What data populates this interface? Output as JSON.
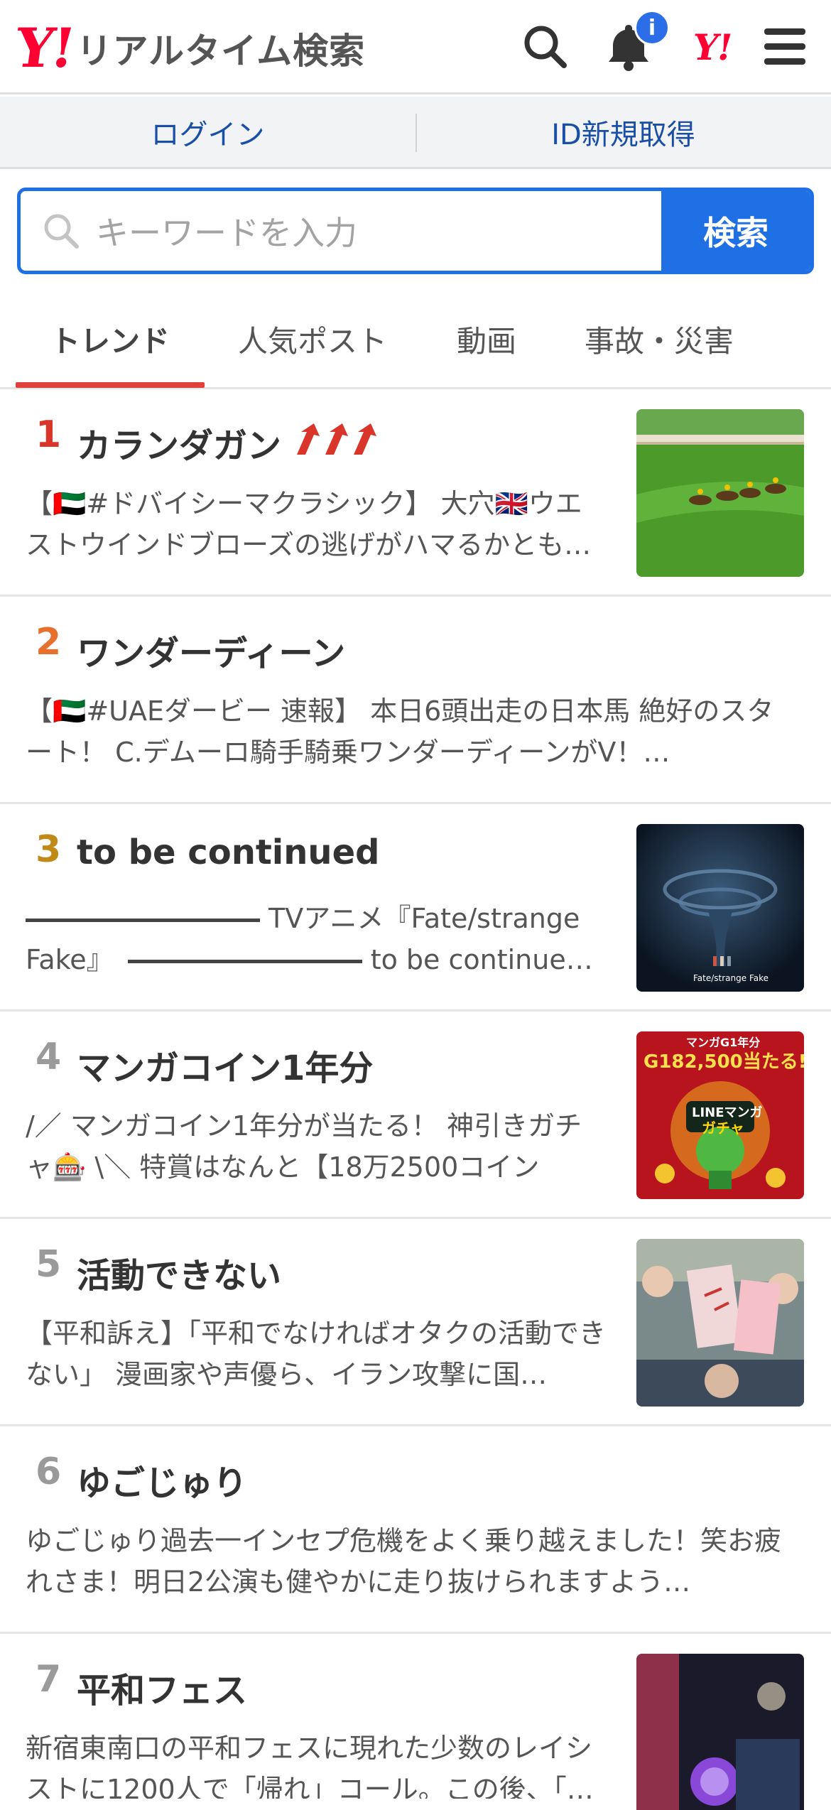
{
  "header": {
    "logo_mark": "Y!",
    "logo_text": "リアルタイム検索",
    "notification_badge": "i",
    "yahoo_mark": "Y!"
  },
  "account": {
    "login": "ログイン",
    "signup": "ID新規取得"
  },
  "search": {
    "placeholder": "キーワードを入力",
    "button": "検索"
  },
  "tabs": [
    {
      "label": "トレンド"
    },
    {
      "label": "人気ポスト"
    },
    {
      "label": "動画"
    },
    {
      "label": "事故・災害"
    }
  ],
  "colors": {
    "brand_red": "#ff0033",
    "accent_blue": "#1f6fe5",
    "rank1": "#d9352b",
    "rank2": "#e8702e",
    "rank3": "#c08a19",
    "rank_other": "#9a9a9a"
  },
  "trends": [
    {
      "rank": "1",
      "title": "カランダガン",
      "desc": "【🇦🇪#ドバイシーマクラシック】 大穴🇬🇧ウエストウインドブローズの逃げがハマるかとも…",
      "thumb": "horse-race-image"
    },
    {
      "rank": "2",
      "title": "ワンダーディーン",
      "desc": "【🇦🇪#UAEダービー 速報】 本日6頭出走の日本馬 絶好のスタート！ C.デムーロ騎手騎乗ワンダーディーンがV！…",
      "thumb": ""
    },
    {
      "rank": "3",
      "title": "to be continued",
      "desc_line1_text": "TVアニメ『Fate/strange",
      "desc_line2_start": "Fake』",
      "desc_line2_end": "to be continue…",
      "thumb": "anime-storm-image",
      "thumb_caption": "Fate/strange Fake"
    },
    {
      "rank": "4",
      "title": "マンガコイン1年分",
      "desc": "/／ マンガコイン1年分が当たる！ 神引きガチャ🎰 \\＼ 特賞はなんと【18万2500コイン🪙】…",
      "thumb": "manga-gacha-image",
      "thumb_text_top": "マンガG1年分",
      "thumb_text_amount": "G182,500当たる!",
      "thumb_text_brand": "LINEマンガ",
      "thumb_text_gacha": "ガチャ"
    },
    {
      "rank": "5",
      "title": "活動できない",
      "desc": "【平和訴え】「平和でなければオタクの活動できない」 漫画家や声優ら、イラン攻撃に国…",
      "thumb": "protest-image"
    },
    {
      "rank": "6",
      "title": "ゆごじゅり",
      "desc": "ゆごじゅり過去一インセプ危機をよく乗り越えました！笑お疲れさま！明日2公演も健やかに走り抜けられますよう…",
      "thumb": ""
    },
    {
      "rank": "7",
      "title": "平和フェス",
      "desc": "新宿東南口の平和フェスに現れた少数のレイシストに1200人で「帰れ」コール。この後、「…",
      "thumb": "night-crowd-image"
    }
  ]
}
